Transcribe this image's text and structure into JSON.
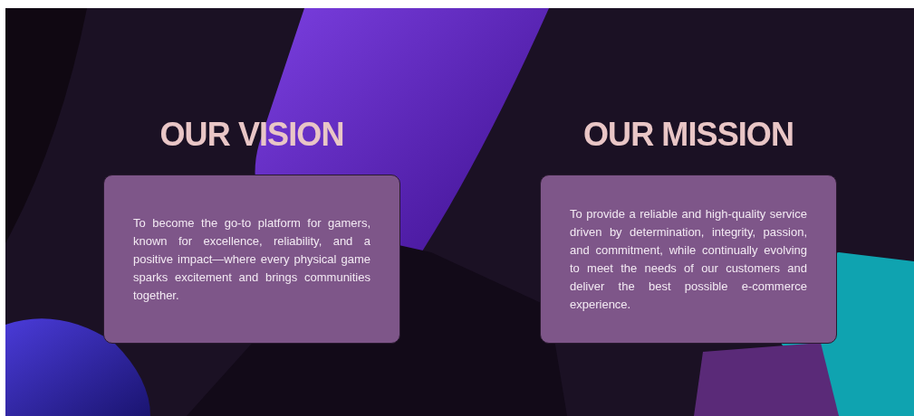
{
  "sections": [
    {
      "heading": "OUR VISION",
      "text": "To become the go-to platform for gamers, known for excellence, reliability, and a positive impact—where every physical game sparks excitement and brings communities together."
    },
    {
      "heading": "OUR MISSION",
      "text": "To provide a reliable and high-quality service driven by determination, integrity, passion, and commitment, while continually evolving to meet the needs of our customers and deliver the best possible e-commerce experience."
    }
  ]
}
